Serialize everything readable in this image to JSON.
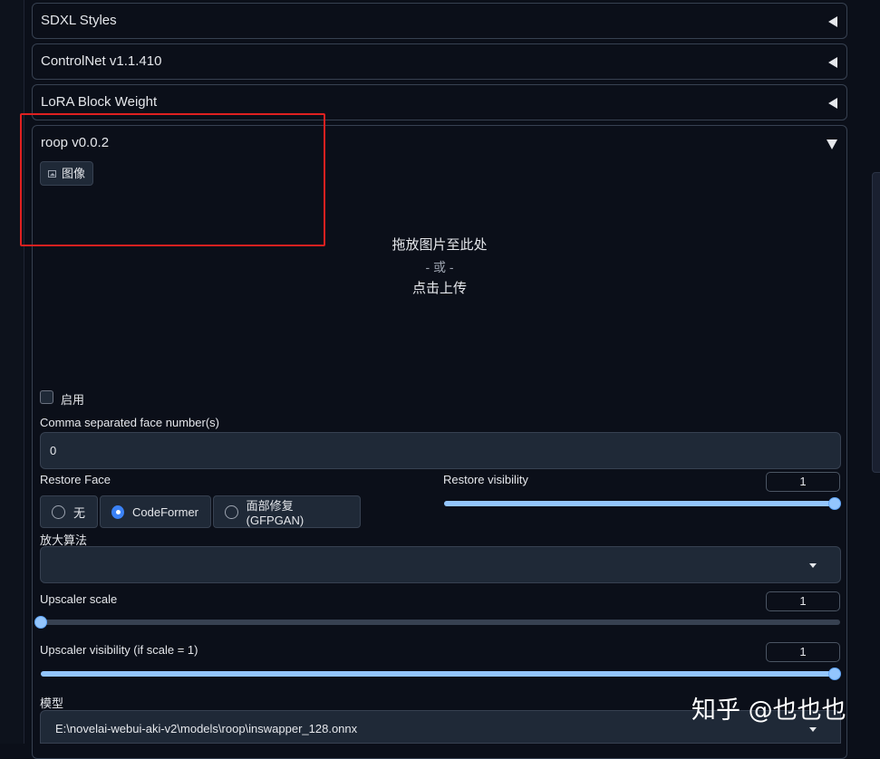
{
  "accordions": [
    {
      "title": "SDXL Styles"
    },
    {
      "title": "ControlNet v1.1.410"
    },
    {
      "title": "LoRA Block Weight"
    },
    {
      "title": "roop v0.0.2"
    }
  ],
  "roop": {
    "image_tab": "图像",
    "drop_text": "拖放图片至此处",
    "drop_or": "- 或 -",
    "drop_click": "点击上传",
    "enable_label": "启用",
    "face_number_label": "Comma separated face number(s)",
    "face_number_value": "0",
    "restore_face_label": "Restore Face",
    "restore_options": [
      "无",
      "CodeFormer",
      "面部修复(GFPGAN)"
    ],
    "restore_selected": "CodeFormer",
    "restore_visibility_label": "Restore visibility",
    "restore_visibility_value": "1",
    "restore_visibility_fraction": 1.0,
    "upscaler_label": "放大算法",
    "upscaler_value": "",
    "upscaler_scale_label": "Upscaler scale",
    "upscaler_scale_value": "1",
    "upscaler_scale_fraction": 0.0,
    "upscaler_visibility_label": "Upscaler visibility (if scale = 1)",
    "upscaler_visibility_value": "1",
    "upscaler_visibility_fraction": 1.0,
    "model_label": "模型",
    "model_value": "E:\\novelai-webui-aki-v2\\models\\roop\\inswapper_128.onnx"
  },
  "watermark": "知乎 @也也也",
  "colors": {
    "accent": "#3b82f6",
    "slider": "#93c5fd",
    "highlight": "#e02020"
  }
}
